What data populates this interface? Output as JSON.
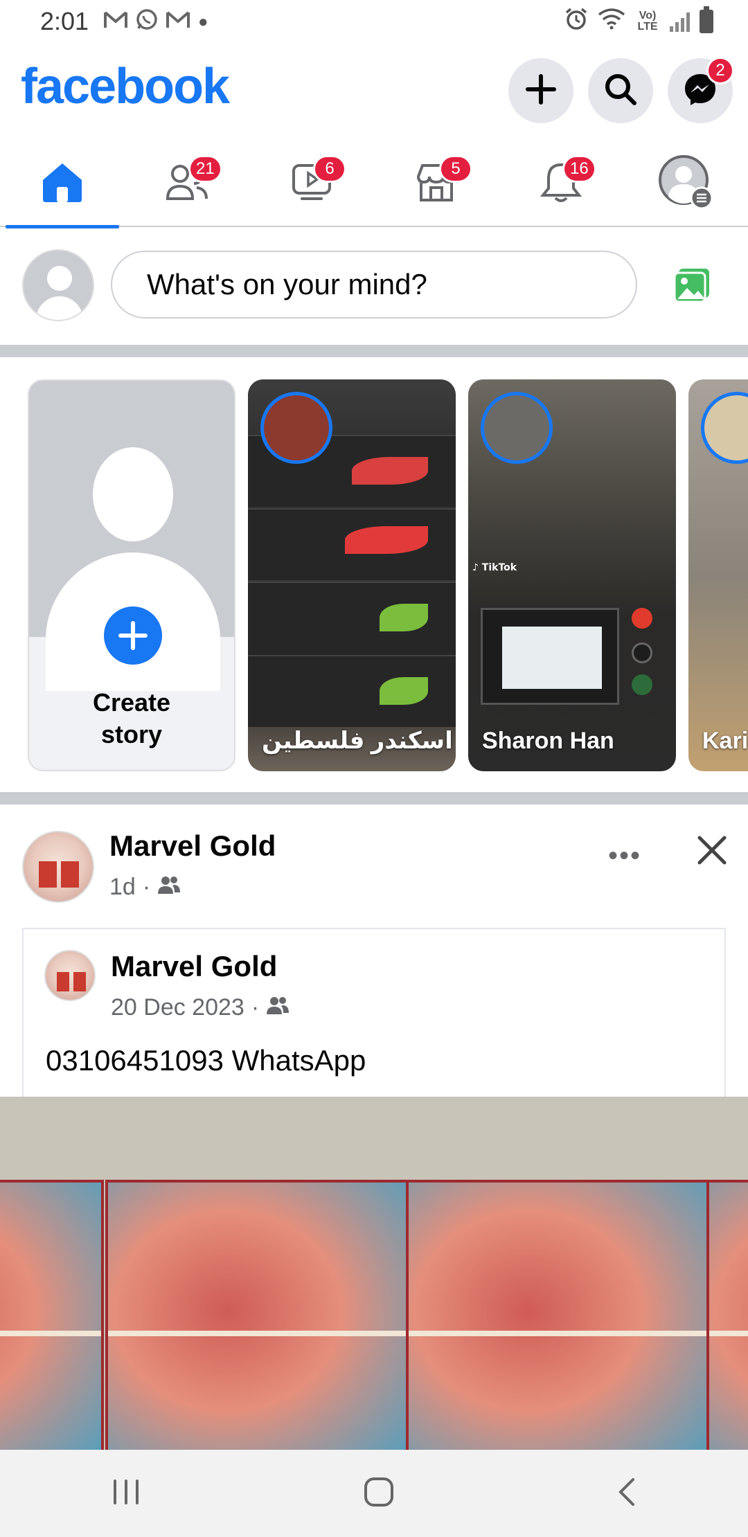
{
  "status_bar": {
    "time": "2:01",
    "network_label": "Vo) LTE",
    "left_icons": [
      "gmail-icon",
      "whatsapp-icon",
      "gmail-icon",
      "dot-icon"
    ],
    "right_icons": [
      "alarm-icon",
      "wifi-icon",
      "signal-icon",
      "battery-icon"
    ]
  },
  "header": {
    "logo": "facebook",
    "brand_color": "#1877f2",
    "buttons": [
      {
        "icon": "plus-icon",
        "badge": ""
      },
      {
        "icon": "search-icon",
        "badge": ""
      },
      {
        "icon": "messenger-icon",
        "badge": "2"
      }
    ]
  },
  "tabs": [
    {
      "name": "home",
      "icon": "home-icon",
      "badge": "",
      "active": true
    },
    {
      "name": "friends",
      "icon": "friends-icon",
      "badge": "21"
    },
    {
      "name": "watch",
      "icon": "video-icon",
      "badge": "6"
    },
    {
      "name": "marketplace",
      "icon": "marketplace-icon",
      "badge": "5"
    },
    {
      "name": "notifications",
      "icon": "bell-icon",
      "badge": "16"
    },
    {
      "name": "menu",
      "icon": "profile-menu-icon",
      "badge": ""
    }
  ],
  "composer": {
    "placeholder": "What's on your mind?"
  },
  "stories": {
    "create_label_line1": "Create",
    "create_label_line2": "story",
    "items": [
      {
        "name": "اسکندر فلسطین"
      },
      {
        "name": "Sharon Han"
      },
      {
        "name": "Kari"
      }
    ]
  },
  "post": {
    "author": "Marvel Gold",
    "time": "1d",
    "shared": {
      "author": "Marvel Gold",
      "date": "20 Dec 2023",
      "text": "03106451093 WhatsApp"
    }
  },
  "nav": {
    "icons": [
      "recent-apps-icon",
      "home-nav-icon",
      "back-icon"
    ]
  }
}
